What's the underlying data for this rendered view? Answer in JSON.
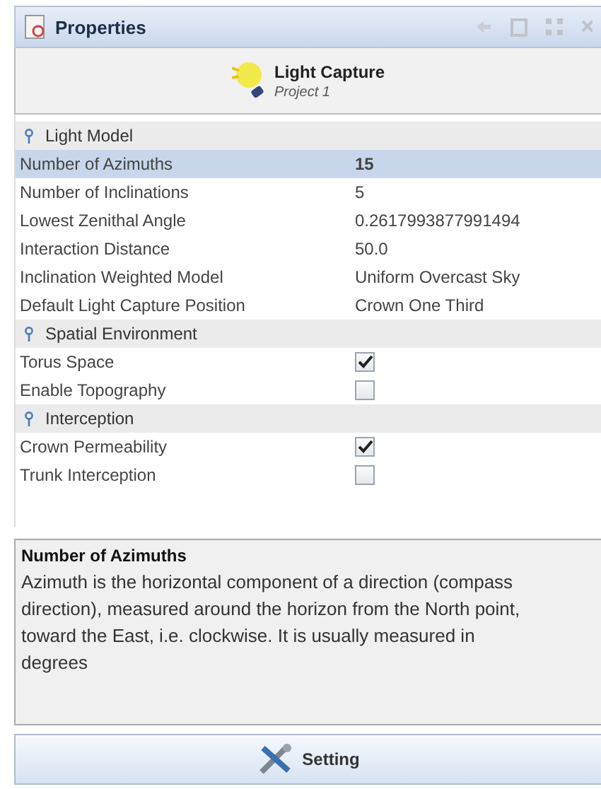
{
  "window": {
    "title": "Properties"
  },
  "header": {
    "title": "Light Capture",
    "subtitle": "Project 1"
  },
  "sections": [
    {
      "title": "Light Model",
      "expanded": true,
      "rows": [
        {
          "kind": "text",
          "label": "Number of Azimuths",
          "value": "15",
          "selected": true
        },
        {
          "kind": "text",
          "label": "Number of Inclinations",
          "value": "5",
          "selected": false
        },
        {
          "kind": "text",
          "label": "Lowest Zenithal Angle",
          "value": "0.2617993877991494",
          "selected": false
        },
        {
          "kind": "text",
          "label": "Interaction Distance",
          "value": "50.0",
          "selected": false
        },
        {
          "kind": "text",
          "label": "Inclination Weighted Model",
          "value": "Uniform Overcast Sky",
          "selected": false
        },
        {
          "kind": "text",
          "label": "Default Light Capture Position",
          "value": "Crown One Third",
          "selected": false
        }
      ]
    },
    {
      "title": "Spatial Environment",
      "expanded": true,
      "rows": [
        {
          "kind": "check",
          "label": "Torus Space",
          "checked": true,
          "selected": false
        },
        {
          "kind": "check",
          "label": "Enable Topography",
          "checked": false,
          "selected": false
        }
      ]
    },
    {
      "title": "Interception",
      "expanded": true,
      "rows": [
        {
          "kind": "check",
          "label": "Crown Permeability",
          "checked": true,
          "selected": false
        },
        {
          "kind": "check",
          "label": "Trunk Interception",
          "checked": false,
          "selected": false
        }
      ]
    }
  ],
  "description": {
    "title": "Number of Azimuths",
    "text": "Azimuth is the horizontal component of a direction (compass direction), measured around the horizon from the North point, toward the East, i.e. clockwise. It is usually measured in degrees"
  },
  "button": {
    "label": "Setting"
  }
}
